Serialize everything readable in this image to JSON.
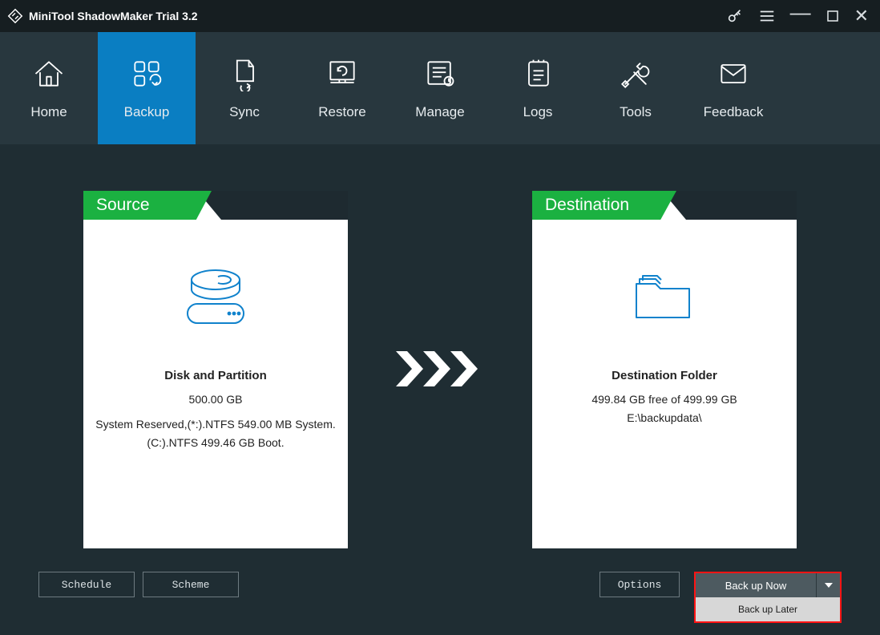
{
  "app": {
    "title": "MiniTool ShadowMaker Trial 3.2"
  },
  "nav": {
    "items": [
      {
        "label": "Home"
      },
      {
        "label": "Backup"
      },
      {
        "label": "Sync"
      },
      {
        "label": "Restore"
      },
      {
        "label": "Manage"
      },
      {
        "label": "Logs"
      },
      {
        "label": "Tools"
      },
      {
        "label": "Feedback"
      }
    ],
    "active": "Backup"
  },
  "source": {
    "header": "Source",
    "title": "Disk and Partition",
    "size": "500.00 GB",
    "detail1": "System Reserved,(*:).NTFS 549.00 MB System.",
    "detail2": "(C:).NTFS 499.46 GB Boot."
  },
  "destination": {
    "header": "Destination",
    "title": "Destination Folder",
    "free": "499.84 GB free of 499.99 GB",
    "path": "E:\\backupdata\\"
  },
  "buttons": {
    "schedule": "Schedule",
    "scheme": "Scheme",
    "options": "Options",
    "backup_now": "Back up Now",
    "backup_later": "Back up Later"
  }
}
